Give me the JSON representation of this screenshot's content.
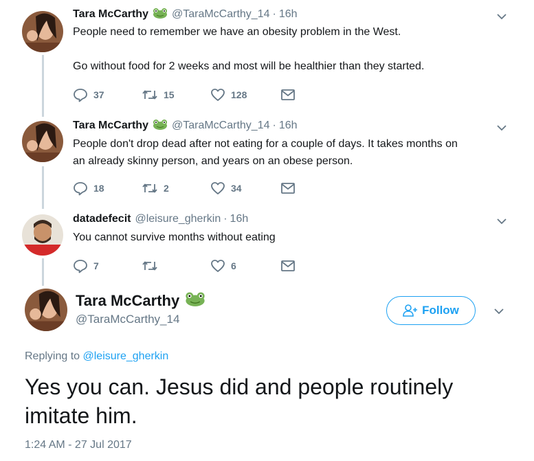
{
  "tweets": [
    {
      "name": "Tara McCarthy",
      "handle": "@TaraMcCarthy_14",
      "time": "16h",
      "text_lines": [
        "People need to remember we have an obesity problem in the West.",
        "",
        "Go without food for 2 weeks and most will be healthier than they started."
      ],
      "replies": "37",
      "retweets": "15",
      "likes": "128",
      "icon": "frog-emoji"
    },
    {
      "name": "Tara McCarthy",
      "handle": "@TaraMcCarthy_14",
      "time": "16h",
      "text_lines": [
        "People don't drop dead after not eating for a couple of days. It takes months on",
        "an already skinny person, and years on an obese person."
      ],
      "replies": "18",
      "retweets": "2",
      "likes": "34",
      "icon": "frog-emoji"
    },
    {
      "name": "datadefecit",
      "handle": "@leisure_gherkin",
      "time": "16h",
      "text_lines": [
        "You cannot survive months without eating"
      ],
      "replies": "7",
      "retweets": "",
      "likes": "6"
    }
  ],
  "main": {
    "name": "Tara McCarthy",
    "handle": "@TaraMcCarthy_14",
    "follow_label": "Follow",
    "replying_prefix": "Replying to",
    "replying_to": "@leisure_gherkin",
    "text_lines": [
      "Yes you can. Jesus did and people routinely",
      "imitate him."
    ],
    "timestamp": "1:24 AM - 27 Jul 2017"
  },
  "colors": {
    "accent": "#1da1f2",
    "secondary_text": "#657786",
    "thread_line": "#ccd6dd"
  }
}
